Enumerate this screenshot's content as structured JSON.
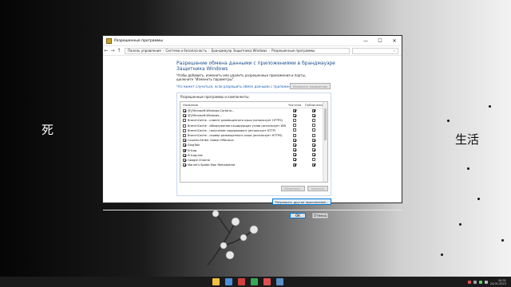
{
  "desktop": {
    "left_char": "死",
    "right_char": "生活"
  },
  "window": {
    "title": "Разрешенные программы",
    "controls": {
      "minimize": "—",
      "maximize": "☐",
      "close": "✕"
    },
    "address": {
      "back": "←",
      "forward": "→",
      "up": "↑",
      "breadcrumb": [
        "Панель управления",
        "Система и безопасность",
        "Брандмауэр Защитника Windows",
        "Разрешенные программы"
      ],
      "search_icon": "⌕"
    },
    "heading": "Разрешение обмена данными с приложениями в брандмауэре Защитника Windows",
    "description": "Чтобы добавить, изменить или удалить разрешенные приложения и порты, щелкните \"Изменить параметры\".",
    "risk_link": "Что может случиться, если разрешить обмен данными с приложением?",
    "change_settings": "Изменить параметры",
    "group_label": "Разрешенные программы и компоненты:",
    "columns": {
      "name": "Название",
      "private": "Частная",
      "public": "Публичная"
    },
    "rows": [
      {
        "name": "@{Microsoft.Windows.Cortana...",
        "checked": true,
        "private": true,
        "public": true
      },
      {
        "name": "@{Microsoft.Windows...",
        "checked": true,
        "private": true,
        "public": true
      },
      {
        "name": "BranchCache - клиент размещенного кэша (использует HTTPS)",
        "checked": false,
        "private": false,
        "public": false
      },
      {
        "name": "BranchCache - обнаружение кэширующих узлов (использует WSD)",
        "checked": false,
        "private": false,
        "public": false
      },
      {
        "name": "BranchCache - получение содержимого (использует HTTP)",
        "checked": false,
        "private": false,
        "public": false
      },
      {
        "name": "BranchCache - сервер размещенного кэша (использует HTTPS)",
        "checked": false,
        "private": false,
        "public": false
      },
      {
        "name": "Counter-Strike: Global Offensive",
        "checked": true,
        "private": true,
        "public": true
      },
      {
        "name": "DingTalk",
        "checked": true,
        "private": true,
        "public": true
      },
      {
        "name": "EriLag",
        "checked": true,
        "private": true,
        "public": true
      },
      {
        "name": "EriLag.exe",
        "checked": true,
        "private": true,
        "public": true
      },
      {
        "name": "Google Chrome",
        "checked": true,
        "private": true,
        "public": false
      },
      {
        "name": "Marvel's Spider-Man Remastered",
        "checked": true,
        "private": true,
        "public": true
      }
    ],
    "details_button": "Сведения...",
    "delete_button": "Удалить",
    "allow_other_button": "Разрешить другое приложение...",
    "ok_button": "ОК",
    "cancel_button": "Отмена"
  },
  "taskbar": {
    "icons": [
      {
        "name": "explorer-icon",
        "color": "#f0c040"
      },
      {
        "name": "mail-icon",
        "color": "#4a8fd8"
      },
      {
        "name": "media-icon",
        "color": "#d04040"
      },
      {
        "name": "chrome-icon",
        "color": "#3aa757"
      },
      {
        "name": "app-icon",
        "color": "#e05050"
      },
      {
        "name": "settings-icon",
        "color": "#5a8fc8"
      }
    ],
    "time": "10:31",
    "date": "24.01.2023"
  }
}
